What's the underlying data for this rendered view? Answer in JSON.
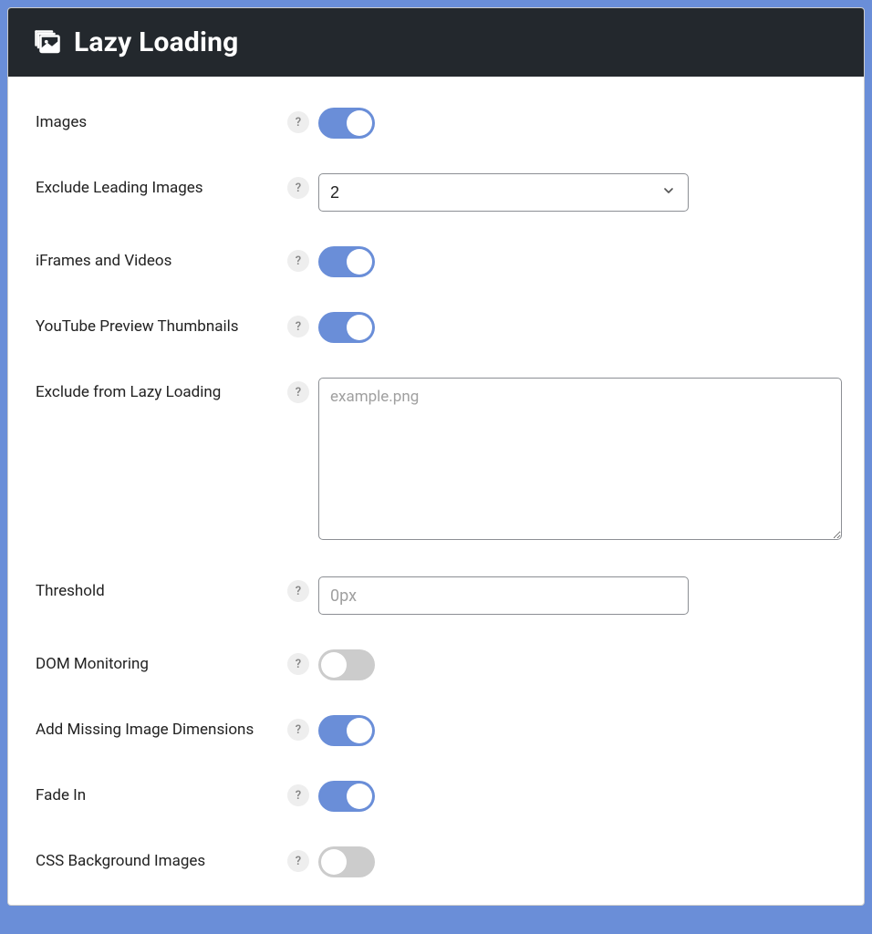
{
  "header": {
    "title": "Lazy Loading",
    "icon": "images-stack-icon"
  },
  "settings": {
    "images": {
      "label": "Images",
      "state": "on"
    },
    "exclude_leading_images": {
      "label": "Exclude Leading Images",
      "value": "2"
    },
    "iframes_videos": {
      "label": "iFrames and Videos",
      "state": "on"
    },
    "youtube_preview": {
      "label": "YouTube Preview Thumbnails",
      "state": "on"
    },
    "exclude_from_lazy": {
      "label": "Exclude from Lazy Loading",
      "placeholder": "example.png",
      "value": ""
    },
    "threshold": {
      "label": "Threshold",
      "placeholder": "0px",
      "value": ""
    },
    "dom_monitoring": {
      "label": "DOM Monitoring",
      "state": "off"
    },
    "add_missing_dims": {
      "label": "Add Missing Image Dimensions",
      "state": "on"
    },
    "fade_in": {
      "label": "Fade In",
      "state": "on"
    },
    "css_background": {
      "label": "CSS Background Images",
      "state": "off"
    }
  },
  "help_glyph": "?"
}
